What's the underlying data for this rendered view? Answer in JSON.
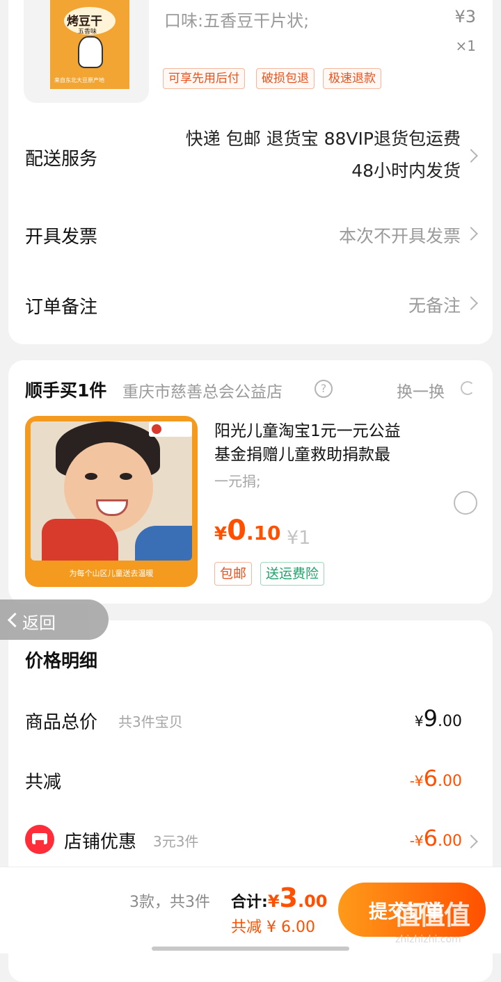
{
  "item": {
    "flavor": "口味:五香豆干片状;",
    "price": "¥3",
    "qty": "×1",
    "tags": [
      "可享先用后付",
      "破损包退",
      "极速退款"
    ],
    "image_text": {
      "brand": "烤豆干",
      "sub": "五香味",
      "bottom": "来自东北大豆原产地"
    }
  },
  "rows": {
    "delivery": {
      "label": "配送服务",
      "line1": "快递 包邮 退货宝 88VIP退货包运费",
      "line2": "48小时内发货"
    },
    "invoice": {
      "label": "开具发票",
      "value": "本次不开具发票"
    },
    "remark": {
      "label": "订单备注",
      "value": "无备注"
    }
  },
  "addon": {
    "title": "顺手买1件",
    "shop": "重庆市慈善总会公益店",
    "swap": "换一换",
    "product_title_1": "阳光儿童淘宝1元一元公益",
    "product_title_2": "基金捐赠儿童救助捐款最",
    "spec": "一元捐;",
    "price_symbol": "¥",
    "price_int": "0",
    "price_dec": ".10",
    "orig_price": "¥1",
    "tags": [
      "包邮",
      "送运费险"
    ],
    "banner": "为每个山区儿童送去温暖"
  },
  "back": {
    "label": "返回"
  },
  "detail": {
    "title": "价格明细",
    "total_label": "商品总价",
    "total_note": "共3件宝贝",
    "total_sym": "¥",
    "total_int": "9",
    "total_dec": ".00",
    "reduce_label": "共减",
    "reduce_sym": "-¥",
    "reduce_int": "6",
    "reduce_dec": ".00",
    "shop_label": "店铺优惠",
    "shop_note": "3元3件",
    "shop_sym": "-¥",
    "shop_int": "6",
    "shop_dec": ".00"
  },
  "footer": {
    "count": "3款，共3件",
    "sum_label": "合计:",
    "sum_sym": "¥",
    "sum_int": "3",
    "sum_dec": ".00",
    "reduce": "共减 ¥ 6.00",
    "submit": "提交订单"
  },
  "watermark": {
    "logo": "值值值",
    "url": "zhizhizhi.com"
  },
  "colors": {
    "accent": "#ff5000",
    "orange_text": "#e8531f",
    "green_tag": "#1ea36b"
  }
}
